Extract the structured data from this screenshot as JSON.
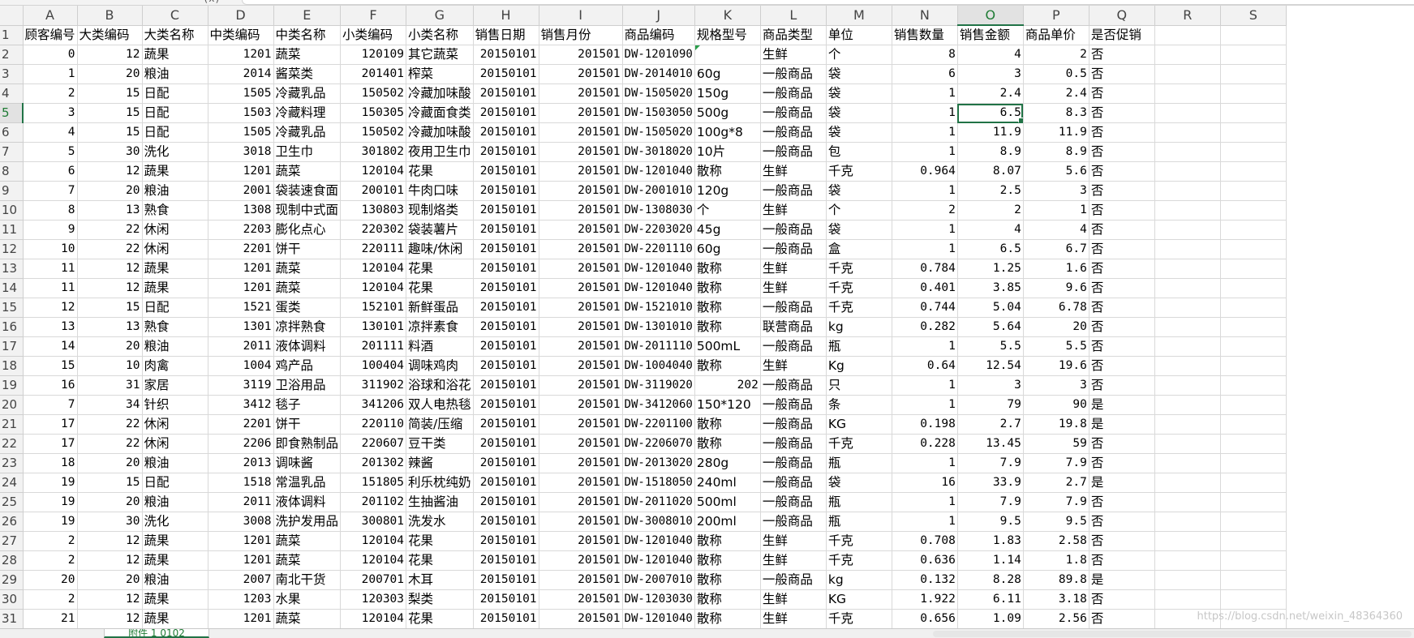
{
  "sheet": {
    "column_letters": [
      "A",
      "B",
      "C",
      "D",
      "E",
      "F",
      "G",
      "H",
      "I",
      "J",
      "K",
      "L",
      "M",
      "N",
      "O",
      "P",
      "Q",
      "R",
      "S"
    ],
    "active_column": "O",
    "active_row": 5,
    "header_row": [
      "顾客编号",
      "大类编码",
      "大类名称",
      "中类编码",
      "中类名称",
      "小类编码",
      "小类名称",
      "销售日期",
      "销售月份",
      "商品编码",
      "规格型号",
      "商品类型",
      "单位",
      "销售数量",
      "销售金额",
      "商品单价",
      "是否促销",
      "",
      ""
    ],
    "rows": [
      [
        "0",
        "12",
        "蔬果",
        "1201",
        "蔬菜",
        "120109",
        "其它蔬菜",
        "20150101",
        "201501",
        "DW-1201090",
        "",
        "生鲜",
        "个",
        "8",
        "4",
        "2",
        "否",
        "",
        ""
      ],
      [
        "1",
        "20",
        "粮油",
        "2014",
        "酱菜类",
        "201401",
        "榨菜",
        "20150101",
        "201501",
        "DW-2014010",
        "60g",
        "一般商品",
        "袋",
        "6",
        "3",
        "0.5",
        "否",
        "",
        ""
      ],
      [
        "2",
        "15",
        "日配",
        "1505",
        "冷藏乳品",
        "150502",
        "冷藏加味酸",
        "20150101",
        "201501",
        "DW-1505020",
        "150g",
        "一般商品",
        "袋",
        "1",
        "2.4",
        "2.4",
        "否",
        "",
        ""
      ],
      [
        "3",
        "15",
        "日配",
        "1503",
        "冷藏料理",
        "150305",
        "冷藏面食类",
        "20150101",
        "201501",
        "DW-1503050",
        "500g",
        "一般商品",
        "袋",
        "1",
        "6.5",
        "8.3",
        "否",
        "",
        ""
      ],
      [
        "4",
        "15",
        "日配",
        "1505",
        "冷藏乳品",
        "150502",
        "冷藏加味酸",
        "20150101",
        "201501",
        "DW-1505020",
        "100g*8",
        "一般商品",
        "袋",
        "1",
        "11.9",
        "11.9",
        "否",
        "",
        ""
      ],
      [
        "5",
        "30",
        "洗化",
        "3018",
        "卫生巾",
        "301802",
        "夜用卫生巾",
        "20150101",
        "201501",
        "DW-3018020",
        "10片",
        "一般商品",
        "包",
        "1",
        "8.9",
        "8.9",
        "否",
        "",
        ""
      ],
      [
        "6",
        "12",
        "蔬果",
        "1201",
        "蔬菜",
        "120104",
        "花果",
        "20150101",
        "201501",
        "DW-1201040",
        "散称",
        "生鲜",
        "千克",
        "0.964",
        "8.07",
        "5.6",
        "否",
        "",
        ""
      ],
      [
        "7",
        "20",
        "粮油",
        "2001",
        "袋装速食面",
        "200101",
        "牛肉口味",
        "20150101",
        "201501",
        "DW-2001010",
        "120g",
        "一般商品",
        "袋",
        "1",
        "2.5",
        "3",
        "否",
        "",
        ""
      ],
      [
        "8",
        "13",
        "熟食",
        "1308",
        "现制中式面",
        "130803",
        "现制烙类",
        "20150101",
        "201501",
        "DW-1308030",
        "个",
        "生鲜",
        "个",
        "2",
        "2",
        "1",
        "否",
        "",
        ""
      ],
      [
        "9",
        "22",
        "休闲",
        "2203",
        "膨化点心",
        "220302",
        "袋装薯片",
        "20150101",
        "201501",
        "DW-2203020",
        "45g",
        "一般商品",
        "袋",
        "1",
        "4",
        "4",
        "否",
        "",
        ""
      ],
      [
        "10",
        "22",
        "休闲",
        "2201",
        "饼干",
        "220111",
        "趣味/休闲",
        "20150101",
        "201501",
        "DW-2201110",
        "60g",
        "一般商品",
        "盒",
        "1",
        "6.5",
        "6.7",
        "否",
        "",
        ""
      ],
      [
        "11",
        "12",
        "蔬果",
        "1201",
        "蔬菜",
        "120104",
        "花果",
        "20150101",
        "201501",
        "DW-1201040",
        "散称",
        "生鲜",
        "千克",
        "0.784",
        "1.25",
        "1.6",
        "否",
        "",
        ""
      ],
      [
        "11",
        "12",
        "蔬果",
        "1201",
        "蔬菜",
        "120104",
        "花果",
        "20150101",
        "201501",
        "DW-1201040",
        "散称",
        "生鲜",
        "千克",
        "0.401",
        "3.85",
        "9.6",
        "否",
        "",
        ""
      ],
      [
        "12",
        "15",
        "日配",
        "1521",
        "蛋类",
        "152101",
        "新鲜蛋品",
        "20150101",
        "201501",
        "DW-1521010",
        "散称",
        "一般商品",
        "千克",
        "0.744",
        "5.04",
        "6.78",
        "否",
        "",
        ""
      ],
      [
        "13",
        "13",
        "熟食",
        "1301",
        "凉拌熟食",
        "130101",
        "凉拌素食",
        "20150101",
        "201501",
        "DW-1301010",
        "散称",
        "联营商品",
        "kg",
        "0.282",
        "5.64",
        "20",
        "否",
        "",
        ""
      ],
      [
        "14",
        "20",
        "粮油",
        "2011",
        "液体调料",
        "201111",
        "料酒",
        "20150101",
        "201501",
        "DW-2011110",
        "500mL",
        "一般商品",
        "瓶",
        "1",
        "5.5",
        "5.5",
        "否",
        "",
        ""
      ],
      [
        "15",
        "10",
        "肉禽",
        "1004",
        "鸡产品",
        "100404",
        "调味鸡肉",
        "20150101",
        "201501",
        "DW-1004040",
        "散称",
        "生鲜",
        "Kg",
        "0.64",
        "12.54",
        "19.6",
        "否",
        "",
        ""
      ],
      [
        "16",
        "31",
        "家居",
        "3119",
        "卫浴用品",
        "311902",
        "浴球和浴花",
        "20150101",
        "201501",
        "DW-3119020",
        "202",
        "一般商品",
        "只",
        "1",
        "3",
        "3",
        "否",
        "",
        ""
      ],
      [
        "7",
        "34",
        "针织",
        "3412",
        "毯子",
        "341206",
        "双人电热毯",
        "20150101",
        "201501",
        "DW-3412060",
        "150*120",
        "一般商品",
        "条",
        "1",
        "79",
        "90",
        "是",
        "",
        ""
      ],
      [
        "17",
        "22",
        "休闲",
        "2201",
        "饼干",
        "220110",
        "简装/压缩",
        "20150101",
        "201501",
        "DW-2201100",
        "散称",
        "一般商品",
        "KG",
        "0.198",
        "2.7",
        "19.8",
        "是",
        "",
        ""
      ],
      [
        "17",
        "22",
        "休闲",
        "2206",
        "即食熟制品",
        "220607",
        "豆干类",
        "20150101",
        "201501",
        "DW-2206070",
        "散称",
        "一般商品",
        "千克",
        "0.228",
        "13.45",
        "59",
        "否",
        "",
        ""
      ],
      [
        "18",
        "20",
        "粮油",
        "2013",
        "调味酱",
        "201302",
        "辣酱",
        "20150101",
        "201501",
        "DW-2013020",
        "280g",
        "一般商品",
        "瓶",
        "1",
        "7.9",
        "7.9",
        "否",
        "",
        ""
      ],
      [
        "19",
        "15",
        "日配",
        "1518",
        "常温乳品",
        "151805",
        "利乐枕纯奶",
        "20150101",
        "201501",
        "DW-1518050",
        "240ml",
        "一般商品",
        "袋",
        "16",
        "33.9",
        "2.7",
        "是",
        "",
        ""
      ],
      [
        "19",
        "20",
        "粮油",
        "2011",
        "液体调料",
        "201102",
        "生抽酱油",
        "20150101",
        "201501",
        "DW-2011020",
        "500ml",
        "一般商品",
        "瓶",
        "1",
        "7.9",
        "7.9",
        "否",
        "",
        ""
      ],
      [
        "19",
        "30",
        "洗化",
        "3008",
        "洗护发用品",
        "300801",
        "洗发水",
        "20150101",
        "201501",
        "DW-3008010",
        "200ml",
        "一般商品",
        "瓶",
        "1",
        "9.5",
        "9.5",
        "否",
        "",
        ""
      ],
      [
        "2",
        "12",
        "蔬果",
        "1201",
        "蔬菜",
        "120104",
        "花果",
        "20150101",
        "201501",
        "DW-1201040",
        "散称",
        "生鲜",
        "千克",
        "0.708",
        "1.83",
        "2.58",
        "否",
        "",
        ""
      ],
      [
        "2",
        "12",
        "蔬果",
        "1201",
        "蔬菜",
        "120104",
        "花果",
        "20150101",
        "201501",
        "DW-1201040",
        "散称",
        "生鲜",
        "千克",
        "0.636",
        "1.14",
        "1.8",
        "否",
        "",
        ""
      ],
      [
        "20",
        "20",
        "粮油",
        "2007",
        "南北干货",
        "200701",
        "木耳",
        "20150101",
        "201501",
        "DW-2007010",
        "散称",
        "一般商品",
        "kg",
        "0.132",
        "8.28",
        "89.8",
        "是",
        "",
        ""
      ],
      [
        "2",
        "12",
        "蔬果",
        "1203",
        "水果",
        "120303",
        "梨类",
        "20150101",
        "201501",
        "DW-1203030",
        "散称",
        "生鲜",
        "KG",
        "1.922",
        "6.11",
        "3.18",
        "否",
        "",
        ""
      ],
      [
        "21",
        "12",
        "蔬果",
        "1201",
        "蔬菜",
        "120104",
        "花果",
        "20150101",
        "201501",
        "DW-1201040",
        "散称",
        "生鲜",
        "千克",
        "0.656",
        "1.09",
        "2.56",
        "否",
        "",
        ""
      ]
    ]
  },
  "sheet_tab": {
    "label": "附件 1 0102"
  },
  "watermark": "https://blog.csdn.net/weixin_48364360"
}
